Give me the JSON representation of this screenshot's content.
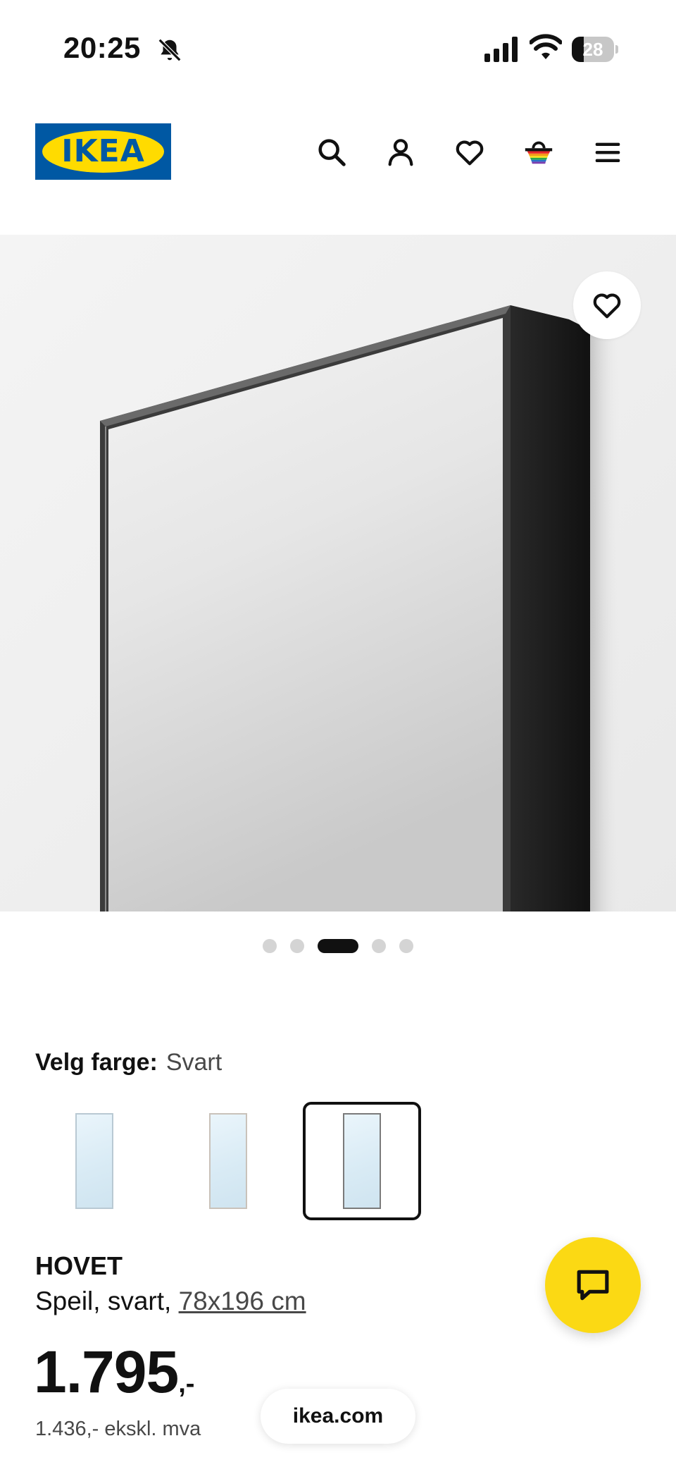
{
  "status_bar": {
    "time": "20:25",
    "battery_level": "28",
    "battery_fraction": 0.28,
    "icons": [
      "bell-off-icon",
      "signal-icon",
      "wifi-icon",
      "battery-icon"
    ]
  },
  "header": {
    "logo_text": "IKEA",
    "brand_colors": {
      "blue": "#0058a3",
      "yellow": "#ffdb00"
    },
    "icons": [
      "search-icon",
      "account-icon",
      "heart-icon",
      "basket-icon",
      "menu-icon"
    ]
  },
  "gallery": {
    "image_count": 5,
    "active_index": 2
  },
  "color_selector": {
    "label": "Velg farge:",
    "selected_value": "Svart",
    "options_count": 3,
    "selected_index": 2
  },
  "product": {
    "name": "HOVET",
    "description_prefix": "Speil, svart, ",
    "size": "78x196 cm",
    "price_main": "1.795",
    "price_suffix": ",-",
    "price_ex_vat": "1.436,- ekskl. mva"
  },
  "chat": {
    "icon": "chat-icon",
    "color": "#fbd914"
  },
  "browser": {
    "url": "ikea.com"
  }
}
